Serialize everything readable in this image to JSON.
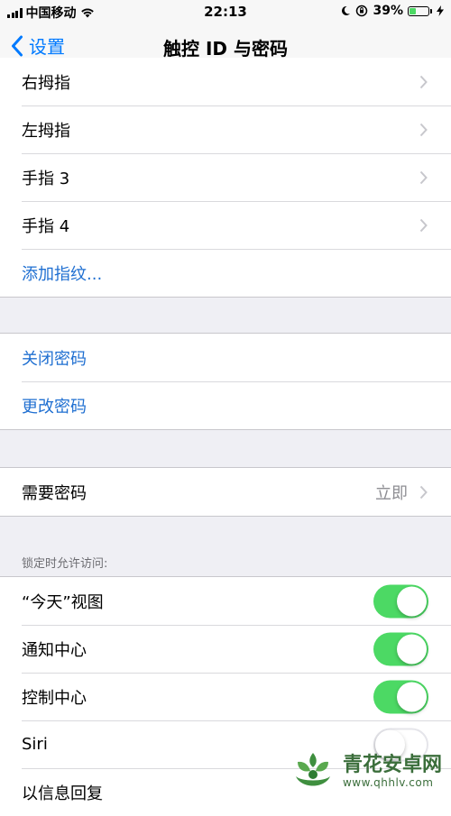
{
  "status_bar": {
    "carrier": "中国移动",
    "time": "22:13",
    "battery_percent": "39%",
    "battery_level": 0.39
  },
  "nav": {
    "back_label": "设置",
    "title": "触控 ID 与密码"
  },
  "fingerprints": {
    "items": [
      {
        "label": "右拇指"
      },
      {
        "label": "左拇指"
      },
      {
        "label": "手指 3"
      },
      {
        "label": "手指 4"
      }
    ],
    "add_label": "添加指纹..."
  },
  "passcode": {
    "turn_off_label": "关闭密码",
    "change_label": "更改密码"
  },
  "require_passcode": {
    "label": "需要密码",
    "value": "立即"
  },
  "lock_access": {
    "header": "锁定时允许访问:",
    "items": [
      {
        "label": "“今天”视图",
        "on": true
      },
      {
        "label": "通知中心",
        "on": true
      },
      {
        "label": "控制中心",
        "on": true
      },
      {
        "label": "Siri",
        "on": false
      },
      {
        "label": "以信息回复",
        "on": null
      }
    ]
  },
  "watermark": {
    "title": "青花安卓网",
    "url": "www.qhhlv.com"
  },
  "colors": {
    "accent": "#007aff",
    "toggle_on": "#4cd964",
    "background": "#efeff4"
  }
}
